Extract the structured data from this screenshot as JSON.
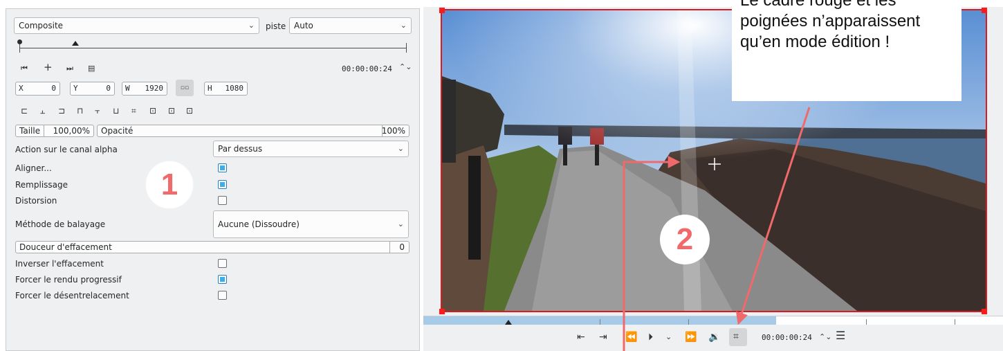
{
  "effect": {
    "composite_label": "Composite",
    "piste_label": "piste",
    "piste_value": "Auto",
    "timecode": "00:00:00:24",
    "x_prefix": "X",
    "x_value": "0",
    "y_prefix": "Y",
    "y_value": "0",
    "w_prefix": "W",
    "w_value": "1920",
    "lock_symbol": "▫▫",
    "h_prefix": "H",
    "h_value": "1080",
    "size_label": "Taille",
    "size_value": "100,00%",
    "opacity_label": "Opacité",
    "opacity_value": "100%",
    "alpha_label": "Action sur le canal alpha",
    "alpha_value": "Par dessus",
    "align_label": "Aligner...",
    "align_checked": true,
    "fill_label": "Remplissage",
    "fill_checked": true,
    "distort_label": "Distorsion",
    "distort_checked": false,
    "wipe_method_label": "Méthode de balayage",
    "wipe_method_value": "Aucune (Dissoudre)",
    "softness_label": "Douceur d'effacement",
    "softness_value": "0",
    "invert_label": "Inverser l'effacement",
    "invert_checked": false,
    "progressive_label": "Forcer le rendu progressif",
    "progressive_checked": true,
    "deinterlace_label": "Forcer le désentrelacement",
    "deinterlace_checked": false
  },
  "annotations": {
    "note": "Le cadre rouge et les poignées n’apparaissent qu’en mode édition !",
    "marker1": "1",
    "marker2": "2",
    "arrow_color": "#f06a6c"
  },
  "monitor": {
    "timecode": "00:00:00:24"
  },
  "colors": {
    "frame": "#d81b20",
    "accent": "#3daee9",
    "panel_bg": "#eff0f1"
  }
}
